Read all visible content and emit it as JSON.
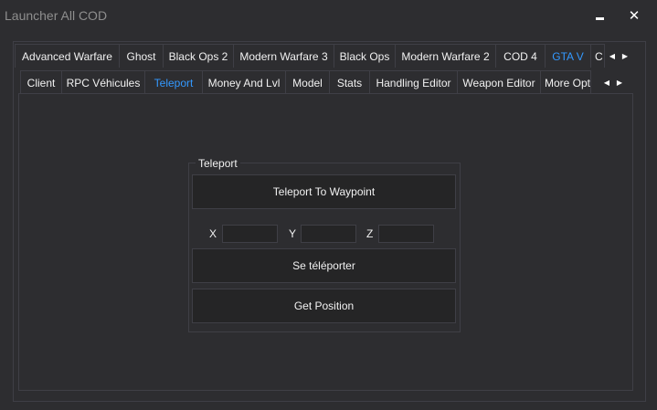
{
  "window": {
    "title": "Launcher All COD",
    "minimize_icon": "minimize-icon",
    "close_glyph": "✕"
  },
  "game_tabs": {
    "items": [
      {
        "label": "Advanced Warfare"
      },
      {
        "label": "Ghost"
      },
      {
        "label": "Black Ops 2"
      },
      {
        "label": "Modern Warfare 3"
      },
      {
        "label": "Black Ops"
      },
      {
        "label": "Modern Warfare 2"
      },
      {
        "label": "COD 4"
      },
      {
        "label": "GTA V"
      },
      {
        "label": "C"
      }
    ],
    "active": "GTA V",
    "scroll_left": "◀",
    "scroll_right": "▶"
  },
  "sub_tabs": {
    "items": [
      {
        "label": "Client"
      },
      {
        "label": "RPC Véhicules"
      },
      {
        "label": "Teleport"
      },
      {
        "label": "Money And Lvl"
      },
      {
        "label": "Model"
      },
      {
        "label": "Stats"
      },
      {
        "label": "Handling Editor"
      },
      {
        "label": "Weapon Editor"
      },
      {
        "label": "More Opti"
      }
    ],
    "active": "Teleport",
    "scroll_left": "◀",
    "scroll_right": "▶"
  },
  "teleport": {
    "group_title": "Teleport",
    "waypoint_button": "Teleport To Waypoint",
    "x_label": "X",
    "y_label": "Y",
    "z_label": "Z",
    "x_value": "",
    "y_value": "",
    "z_value": "",
    "teleport_button": "Se téléporter",
    "get_position_button": "Get Position"
  },
  "colors": {
    "background": "#2d2d30",
    "border": "#3f3f46",
    "button": "#252526",
    "accent": "#3399ff",
    "text": "#f1f1f1"
  }
}
